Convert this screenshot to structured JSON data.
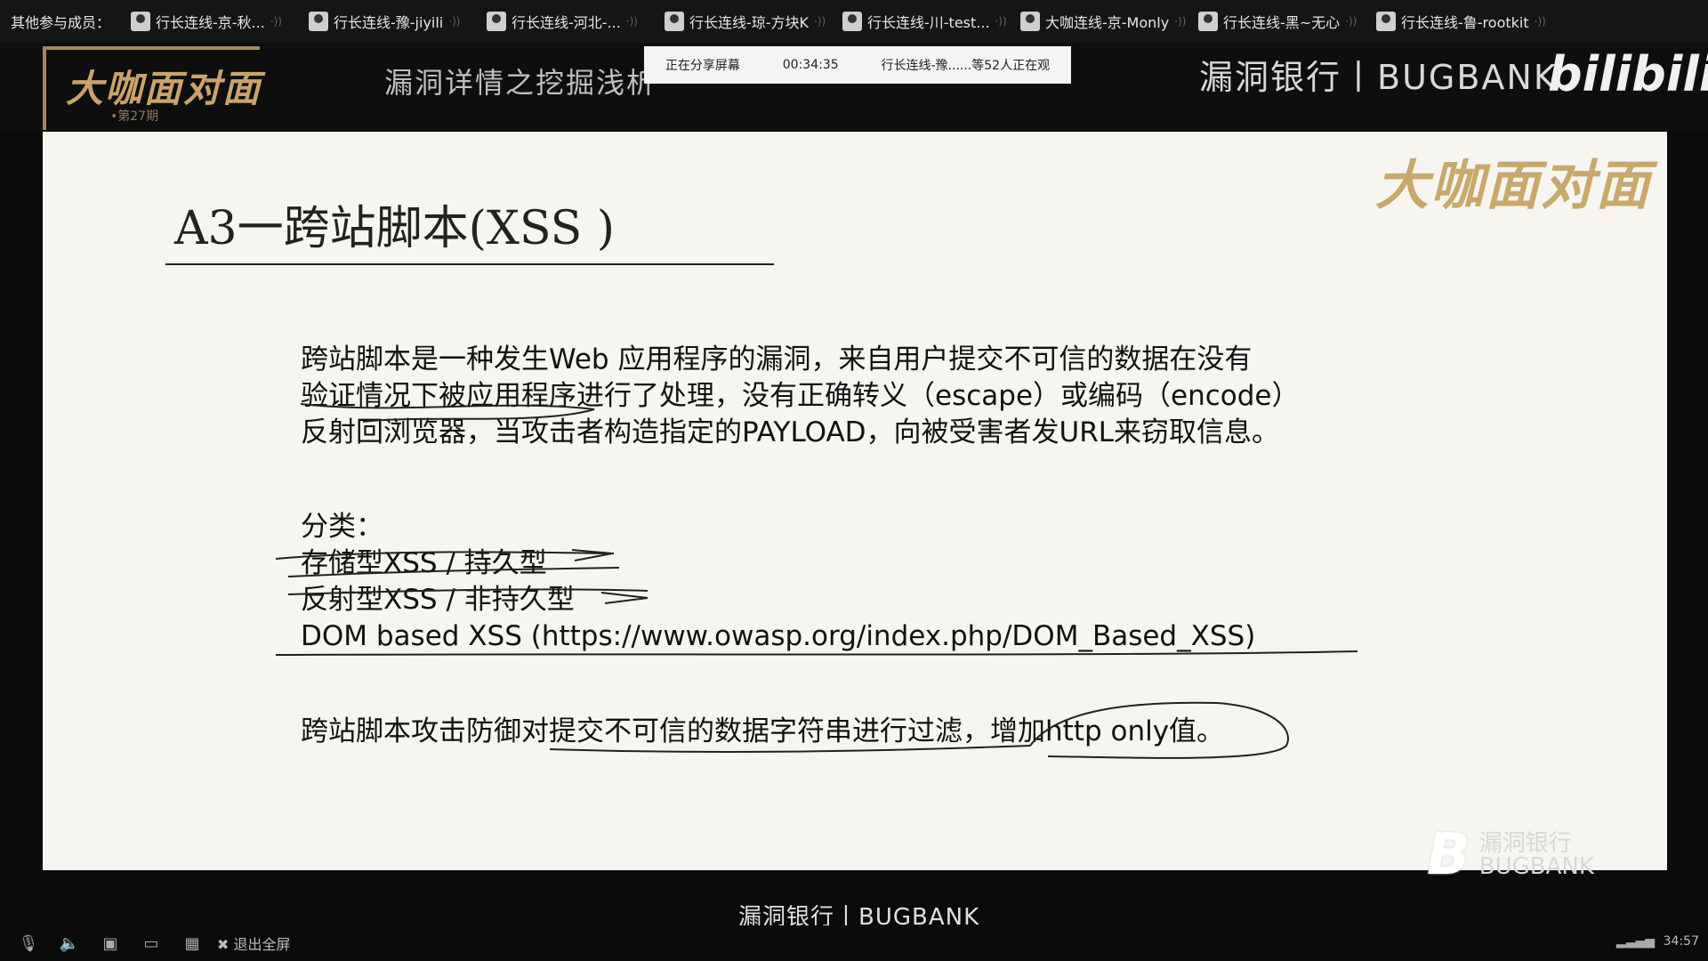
{
  "participants_bar": {
    "label": "其他参与成员：",
    "members": [
      "行长连线-京-秋...",
      "行长连线-豫-jiyili",
      "行长连线-河北-...",
      "行长连线-琼-方块K",
      "行长连线-川-test...",
      "大咖连线-京-Monly",
      "行长连线-黑~无心",
      "行长连线-鲁-rootkit"
    ]
  },
  "banner": {
    "brand_title": "大咖面对面",
    "brand_issue": "•第27期",
    "topic": "漏洞详情之挖掘浅析",
    "share_status": "正在分享屏幕",
    "share_time": "00:34:35",
    "share_viewers": "行长连线-豫......等52人正在观",
    "bugbank": "漏洞银行丨BUGBANK",
    "bilibili": "bilibili"
  },
  "slide": {
    "logo": "大咖面对面",
    "title": "A3一跨站脚本(XSS )",
    "paragraph": [
      "跨站脚本是一种发生Web 应用程序的漏洞，来自用户提交不可信的数据在没有",
      "验证情况下被应用程序进行了处理，没有正确转义（escape）或编码（encode）",
      "反射回浏览器，当攻击者构造指定的PAYLOAD，向被受害者发URL来窃取信息。"
    ],
    "classification_label": "分类：",
    "classification_items": [
      "存储型XSS / 持久型",
      "反射型XSS / 非持久型",
      "DOM based XSS          (https://www.owasp.org/index.php/DOM_Based_XSS)"
    ],
    "defense": "跨站脚本攻击防御对提交不可信的数据字符串进行过滤，增加http only值。",
    "watermark_cn": "漏洞银行",
    "watermark_en": "BUGBANK"
  },
  "bottom_bar": {
    "brand": "漏洞银行丨BUGBANK",
    "exit_fullscreen": "退出全屏",
    "clock": "34:57"
  }
}
